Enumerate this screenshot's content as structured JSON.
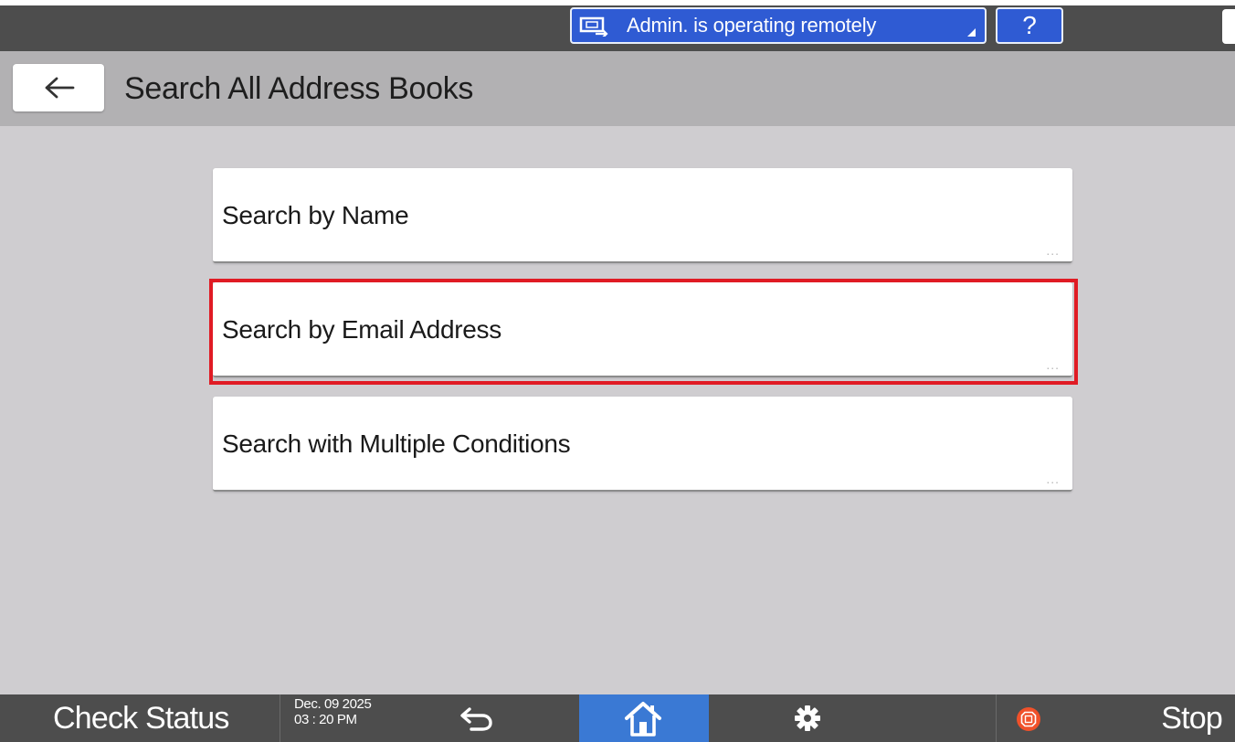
{
  "system_bar": {
    "remote_status": "Admin. is operating remotely",
    "remote_icon": "remote-operation-icon",
    "help_label": "?"
  },
  "header": {
    "back_icon": "arrow-left-icon",
    "title": "Search All Address Books"
  },
  "options": [
    {
      "label": "Search by Name",
      "more_indicator": "..."
    },
    {
      "label": "Search by Email Address",
      "more_indicator": "...",
      "highlighted": true
    },
    {
      "label": "Search with Multiple Conditions",
      "more_indicator": "..."
    }
  ],
  "bottom_bar": {
    "check_status_label": "Check Status",
    "date": "Dec. 09 2025",
    "time": "03 : 20 PM",
    "back_icon": "return-arrow-icon",
    "home_icon": "home-icon",
    "settings_icon": "gear-icon",
    "stop_icon": "stop-icon",
    "stop_label": "Stop"
  },
  "colors": {
    "accent_blue": "#2f5bd3",
    "home_blue": "#3a79d4",
    "highlight_red": "#e01b24",
    "stop_orange": "#f0512a",
    "bar_gray": "#4d4d4d",
    "header_gray": "#b2b1b3",
    "content_gray": "#cfcdd0"
  }
}
